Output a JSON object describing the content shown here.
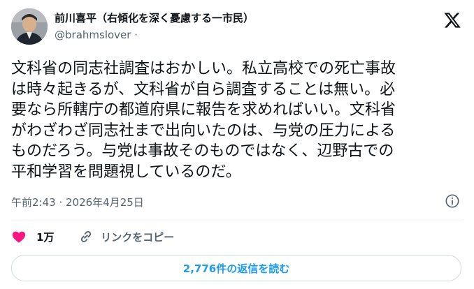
{
  "header": {
    "display_name": "前川喜平（右傾化を深く憂慮する一市民）",
    "handle": "@brahmslover",
    "separator": "·",
    "logo_icon": "x-logo-icon"
  },
  "tweet": {
    "lines": [
      "文科省の同志社調査はおかしい。私立高校での死亡事故",
      "は時々起きるが、文科省が自ら調査することは無い。必",
      "要なら所轄庁の都道府県に報告を求めればいい。文科省",
      "がわざわざ同志社まで出向いたのは、与党の圧力による",
      "ものだろう。与党は事故そのものではなく、辺野古での",
      "平和学習を問題視しているのだ。"
    ]
  },
  "meta": {
    "timestamp": "午前2:43 · 2026年4月25日",
    "info_icon": "info-icon"
  },
  "actions": {
    "like_count": "1万",
    "like_icon": "heart-icon",
    "like_color": "#f91880",
    "copy_link_label": "リンクをコピー",
    "copy_icon": "link-icon"
  },
  "replies": {
    "label": "2,776件の返信を読む"
  },
  "colors": {
    "text": "#0f1419",
    "secondary": "#536471",
    "accent": "#1d9bf0",
    "border": "#cfd9de"
  }
}
